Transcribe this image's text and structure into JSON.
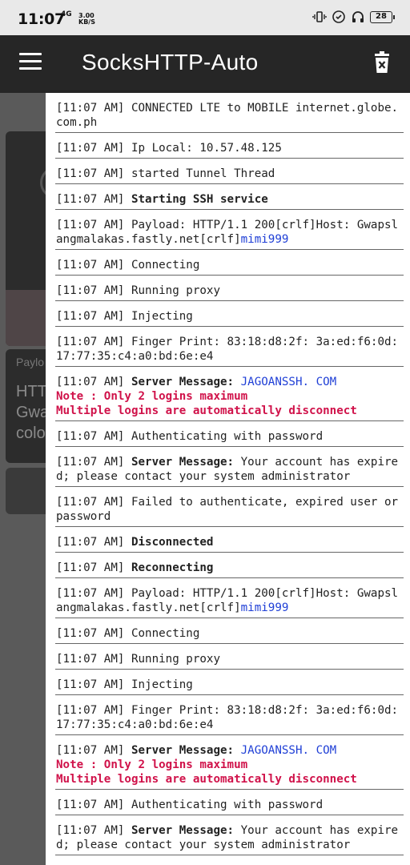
{
  "status_bar": {
    "time": "11:07",
    "network": "4G",
    "speed_value": "3.00",
    "speed_unit": "KB/S",
    "battery": "28"
  },
  "app_bar": {
    "title": "SocksHTTP-Auto",
    "menu_icon": "hamburger-menu-icon",
    "clear_icon": "trash-icon"
  },
  "background": {
    "payload_label": "Paylo",
    "payload_text": [
      "HTT",
      "Gwa",
      "colo"
    ]
  },
  "log": {
    "prefix": "[11:07 AM]",
    "entries": [
      {
        "text": "CONNECTED LTE to MOBILE internet.globe.com.ph"
      },
      {
        "text": "Ip Local: 10.57.48.125"
      },
      {
        "text": "started Tunnel Thread"
      },
      {
        "bold": "Starting SSH service"
      },
      {
        "text": "Payload: HTTP/1.1 200[crlf]Host: Gwapslangmalakas.fastly.net[crlf]",
        "blue": "mimi999"
      },
      {
        "text": "Connecting"
      },
      {
        "text": "Running proxy"
      },
      {
        "text": "Injecting"
      },
      {
        "text": "Finger Print: 83:18:d8:2f: 3a:ed:f6:0d:17:77:35:c4:a0:bd:6e:e4"
      },
      {
        "bold": "Server Message: ",
        "blue": "JAGOANSSH. COM",
        "red": [
          "Note : Only 2 logins maximum",
          "Multiple logins are automatically disconnect"
        ]
      },
      {
        "text": "Authenticating with password"
      },
      {
        "bold": "Server Message: ",
        "text": "Your account has expired; please contact your system administrator"
      },
      {
        "text": "Failed to authenticate, expired user or password"
      },
      {
        "bold": "Disconnected"
      },
      {
        "bold": "Reconnecting"
      },
      {
        "text": "Payload: HTTP/1.1 200[crlf]Host: Gwapslangmalakas.fastly.net[crlf]",
        "blue": "mimi999"
      },
      {
        "text": "Connecting"
      },
      {
        "text": "Running proxy"
      },
      {
        "text": "Injecting"
      },
      {
        "text": "Finger Print: 83:18:d8:2f: 3a:ed:f6:0d:17:77:35:c4:a0:bd:6e:e4"
      },
      {
        "bold": "Server Message: ",
        "blue": "JAGOANSSH. COM",
        "red": [
          "Note : Only 2 logins maximum",
          "Multiple logins are automatically disconnect"
        ]
      },
      {
        "text": "Authenticating with password"
      },
      {
        "bold": "Server Message: ",
        "text": "Your account has expired; please contact your system administrator"
      }
    ]
  },
  "colors": {
    "app_bar": "#262626",
    "status_bar": "#e9e9e9",
    "link_blue": "#1f3fd6",
    "warning_red": "#d0124a"
  }
}
